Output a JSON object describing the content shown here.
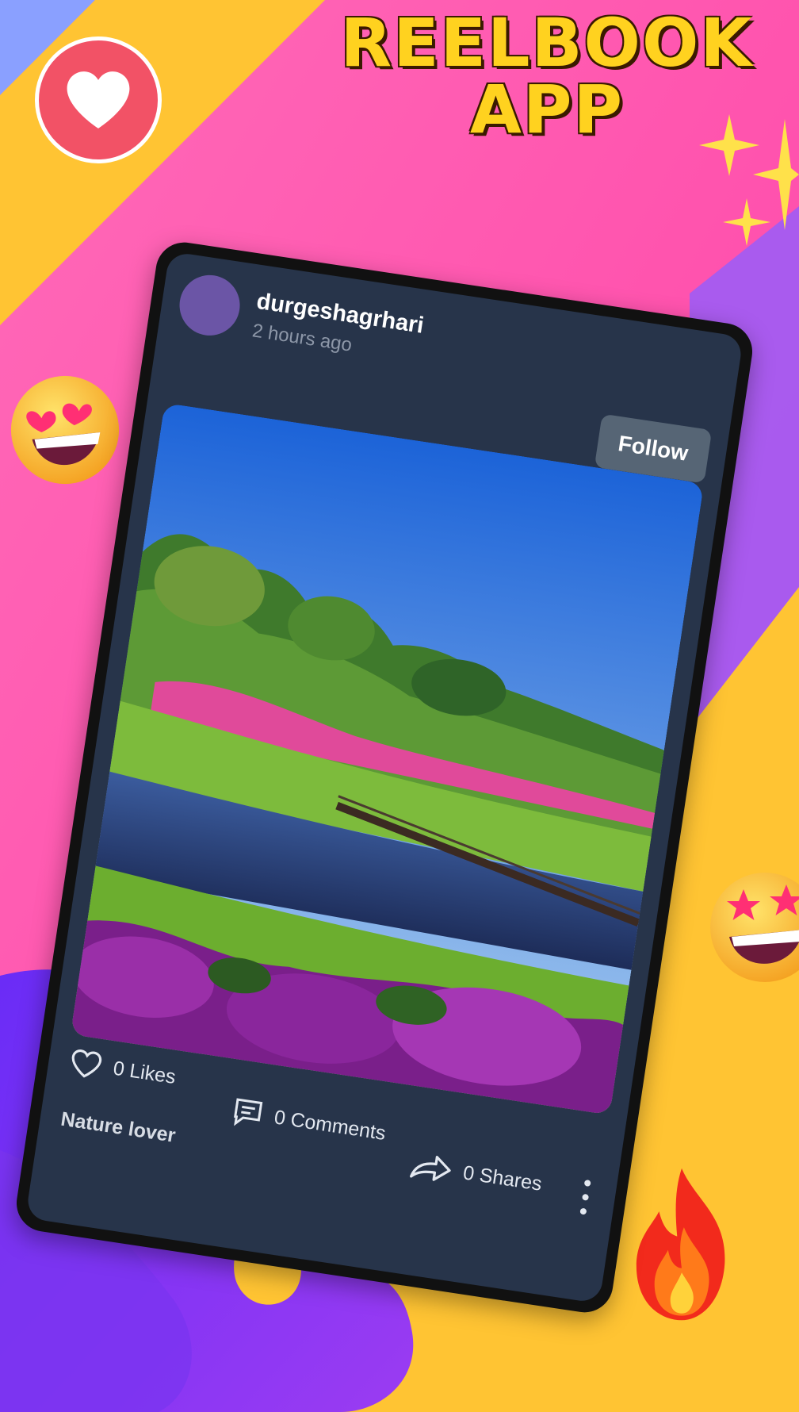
{
  "promo": {
    "title_line1": "REELBOOK",
    "title_line2": "APP"
  },
  "icons": {
    "heart_badge": "heart-icon",
    "emoji_heart_eyes": "heart-eyes-emoji",
    "emoji_star_eyes": "star-eyes-emoji",
    "sparkles": "sparkles-icon",
    "fire": "fire-icon"
  },
  "colors": {
    "background_pink": "#ff55b0",
    "yellow": "#ffc433",
    "purple": "#7a2cf0",
    "card": "#27344a",
    "follow_button": "#566575",
    "heart_badge": "#f25266"
  },
  "post": {
    "username": "durgeshagrhari",
    "time": "2 hours ago",
    "follow_label": "Follow",
    "likes_label": "0 Likes",
    "comments_label": "0 Comments",
    "shares_label": "0 Shares",
    "caption": "Nature lover"
  }
}
